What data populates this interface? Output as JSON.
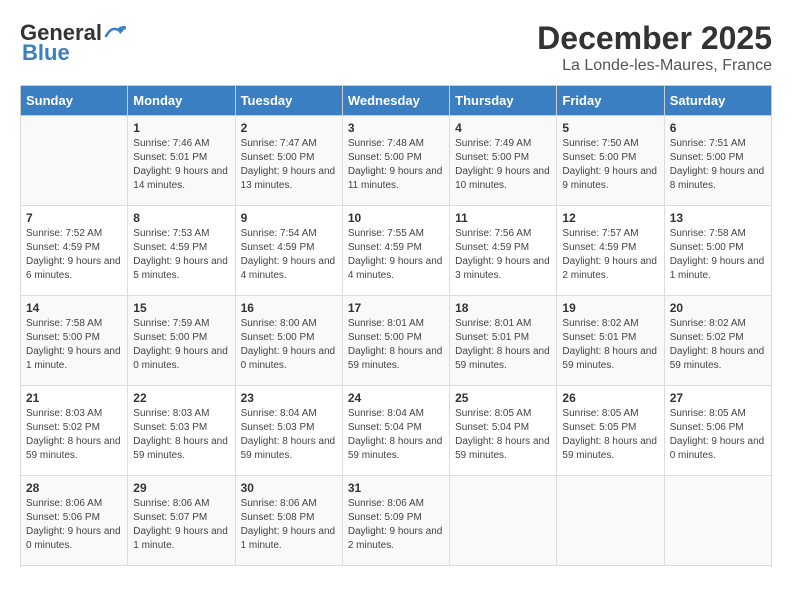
{
  "header": {
    "logo_line1": "General",
    "logo_line2": "Blue",
    "main_title": "December 2025",
    "subtitle": "La Londe-les-Maures, France"
  },
  "days_of_week": [
    "Sunday",
    "Monday",
    "Tuesday",
    "Wednesday",
    "Thursday",
    "Friday",
    "Saturday"
  ],
  "weeks": [
    [
      {
        "day": "",
        "info": ""
      },
      {
        "day": "1",
        "info": "Sunrise: 7:46 AM\nSunset: 5:01 PM\nDaylight: 9 hours and 14 minutes."
      },
      {
        "day": "2",
        "info": "Sunrise: 7:47 AM\nSunset: 5:00 PM\nDaylight: 9 hours and 13 minutes."
      },
      {
        "day": "3",
        "info": "Sunrise: 7:48 AM\nSunset: 5:00 PM\nDaylight: 9 hours and 11 minutes."
      },
      {
        "day": "4",
        "info": "Sunrise: 7:49 AM\nSunset: 5:00 PM\nDaylight: 9 hours and 10 minutes."
      },
      {
        "day": "5",
        "info": "Sunrise: 7:50 AM\nSunset: 5:00 PM\nDaylight: 9 hours and 9 minutes."
      },
      {
        "day": "6",
        "info": "Sunrise: 7:51 AM\nSunset: 5:00 PM\nDaylight: 9 hours and 8 minutes."
      }
    ],
    [
      {
        "day": "7",
        "info": "Sunrise: 7:52 AM\nSunset: 4:59 PM\nDaylight: 9 hours and 6 minutes."
      },
      {
        "day": "8",
        "info": "Sunrise: 7:53 AM\nSunset: 4:59 PM\nDaylight: 9 hours and 5 minutes."
      },
      {
        "day": "9",
        "info": "Sunrise: 7:54 AM\nSunset: 4:59 PM\nDaylight: 9 hours and 4 minutes."
      },
      {
        "day": "10",
        "info": "Sunrise: 7:55 AM\nSunset: 4:59 PM\nDaylight: 9 hours and 4 minutes."
      },
      {
        "day": "11",
        "info": "Sunrise: 7:56 AM\nSunset: 4:59 PM\nDaylight: 9 hours and 3 minutes."
      },
      {
        "day": "12",
        "info": "Sunrise: 7:57 AM\nSunset: 4:59 PM\nDaylight: 9 hours and 2 minutes."
      },
      {
        "day": "13",
        "info": "Sunrise: 7:58 AM\nSunset: 5:00 PM\nDaylight: 9 hours and 1 minute."
      }
    ],
    [
      {
        "day": "14",
        "info": "Sunrise: 7:58 AM\nSunset: 5:00 PM\nDaylight: 9 hours and 1 minute."
      },
      {
        "day": "15",
        "info": "Sunrise: 7:59 AM\nSunset: 5:00 PM\nDaylight: 9 hours and 0 minutes."
      },
      {
        "day": "16",
        "info": "Sunrise: 8:00 AM\nSunset: 5:00 PM\nDaylight: 9 hours and 0 minutes."
      },
      {
        "day": "17",
        "info": "Sunrise: 8:01 AM\nSunset: 5:00 PM\nDaylight: 8 hours and 59 minutes."
      },
      {
        "day": "18",
        "info": "Sunrise: 8:01 AM\nSunset: 5:01 PM\nDaylight: 8 hours and 59 minutes."
      },
      {
        "day": "19",
        "info": "Sunrise: 8:02 AM\nSunset: 5:01 PM\nDaylight: 8 hours and 59 minutes."
      },
      {
        "day": "20",
        "info": "Sunrise: 8:02 AM\nSunset: 5:02 PM\nDaylight: 8 hours and 59 minutes."
      }
    ],
    [
      {
        "day": "21",
        "info": "Sunrise: 8:03 AM\nSunset: 5:02 PM\nDaylight: 8 hours and 59 minutes."
      },
      {
        "day": "22",
        "info": "Sunrise: 8:03 AM\nSunset: 5:03 PM\nDaylight: 8 hours and 59 minutes."
      },
      {
        "day": "23",
        "info": "Sunrise: 8:04 AM\nSunset: 5:03 PM\nDaylight: 8 hours and 59 minutes."
      },
      {
        "day": "24",
        "info": "Sunrise: 8:04 AM\nSunset: 5:04 PM\nDaylight: 8 hours and 59 minutes."
      },
      {
        "day": "25",
        "info": "Sunrise: 8:05 AM\nSunset: 5:04 PM\nDaylight: 8 hours and 59 minutes."
      },
      {
        "day": "26",
        "info": "Sunrise: 8:05 AM\nSunset: 5:05 PM\nDaylight: 8 hours and 59 minutes."
      },
      {
        "day": "27",
        "info": "Sunrise: 8:05 AM\nSunset: 5:06 PM\nDaylight: 9 hours and 0 minutes."
      }
    ],
    [
      {
        "day": "28",
        "info": "Sunrise: 8:06 AM\nSunset: 5:06 PM\nDaylight: 9 hours and 0 minutes."
      },
      {
        "day": "29",
        "info": "Sunrise: 8:06 AM\nSunset: 5:07 PM\nDaylight: 9 hours and 1 minute."
      },
      {
        "day": "30",
        "info": "Sunrise: 8:06 AM\nSunset: 5:08 PM\nDaylight: 9 hours and 1 minute."
      },
      {
        "day": "31",
        "info": "Sunrise: 8:06 AM\nSunset: 5:09 PM\nDaylight: 9 hours and 2 minutes."
      },
      {
        "day": "",
        "info": ""
      },
      {
        "day": "",
        "info": ""
      },
      {
        "day": "",
        "info": ""
      }
    ]
  ]
}
